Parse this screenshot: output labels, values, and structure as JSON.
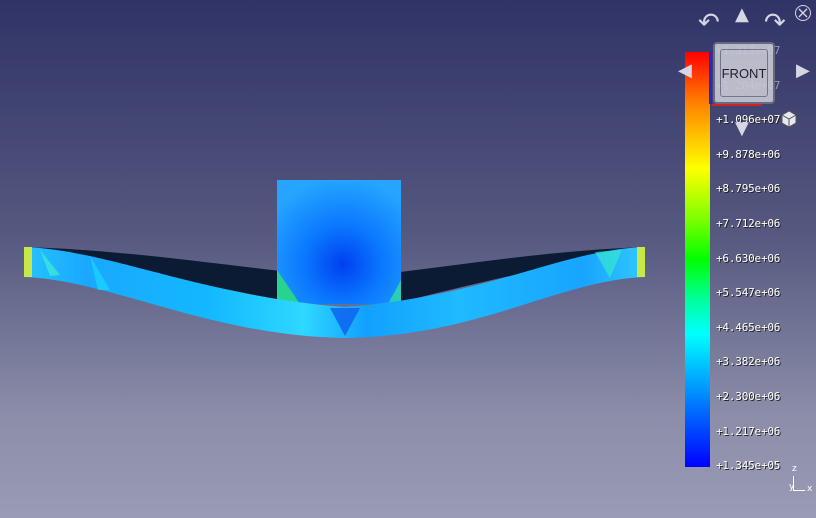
{
  "navcube": {
    "face_label": "FRONT",
    "arrows": {
      "up": "▲",
      "down": "▼",
      "left": "◀",
      "right": "▶",
      "rotate_ccw": "↶",
      "rotate_cw": "↷"
    },
    "menu_icon": "view-menu-icon",
    "close_glyph": "×"
  },
  "legend": {
    "labels": [
      "+1.313e+07",
      "+1.204e+07",
      "+1.096e+07",
      "+9.878e+06",
      "+8.795e+06",
      "+7.712e+06",
      "+6.630e+06",
      "+5.547e+06",
      "+4.465e+06",
      "+3.382e+06",
      "+2.300e+06",
      "+1.217e+06",
      "+1.345e+05"
    ],
    "colors": [
      "#ff0000",
      "#ffff00",
      "#00ff00",
      "#00ffff",
      "#0000ff"
    ]
  },
  "axes": {
    "z": "z",
    "y": "y",
    "x": "x"
  }
}
